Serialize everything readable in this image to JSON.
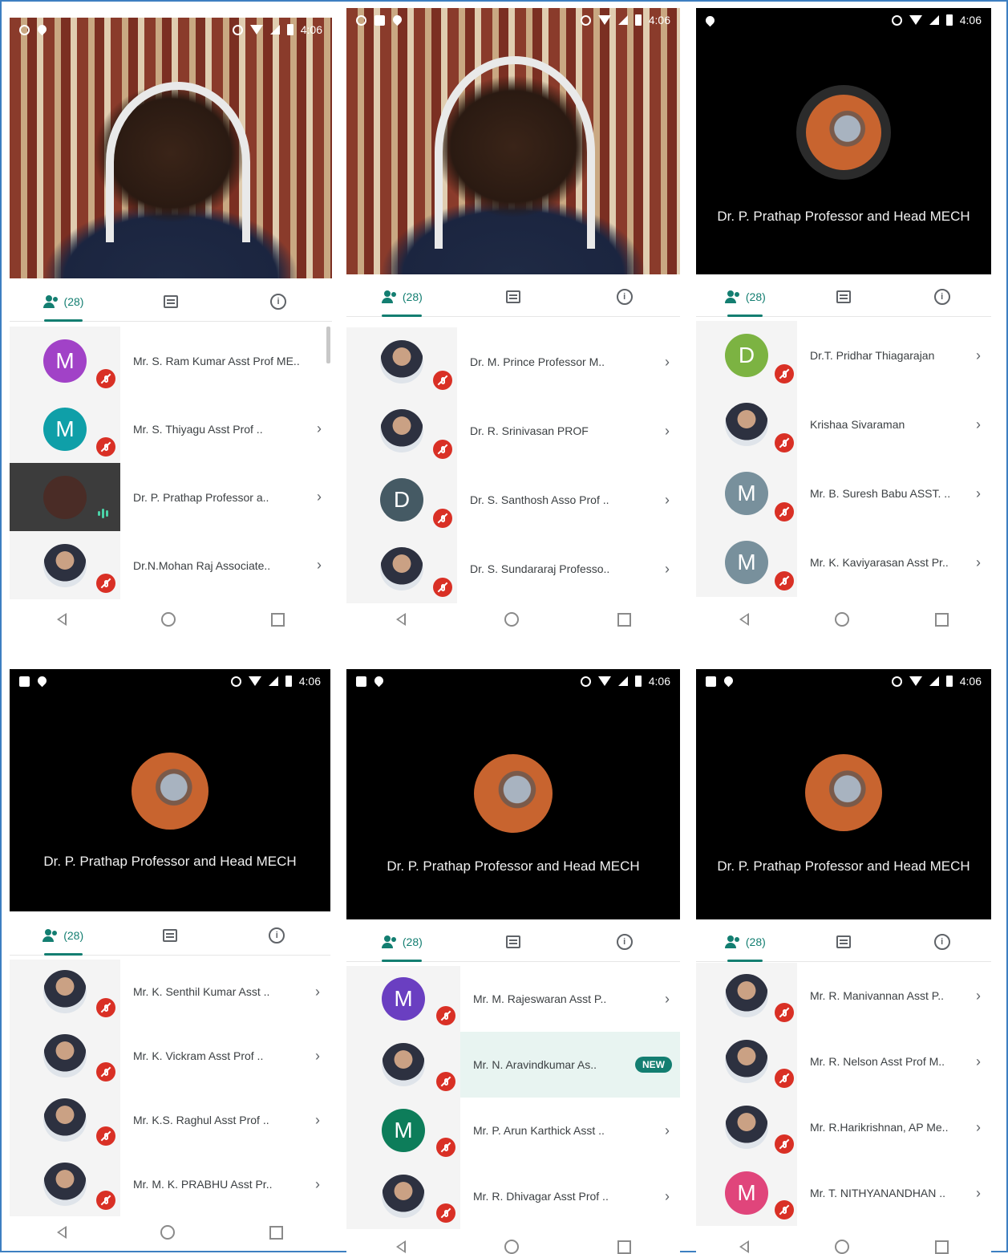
{
  "status_time": "4:06",
  "participants_count": "(28)",
  "presenter_name": "Dr. P. Prathap Professor and Head MECH",
  "panels": [
    {
      "rows": [
        {
          "name": "Mr. S. Ram Kumar Asst Prof ME..",
          "initial": "M",
          "color": "#a142c7"
        },
        {
          "name": "Mr. S. Thiyagu Asst Prof ..",
          "initial": "M",
          "color": "#0f9fa8"
        },
        {
          "name": "Dr. P. Prathap Professor a..",
          "initial": "",
          "color": "#4a2c26"
        },
        {
          "name": "Dr.N.Mohan Raj Associate..",
          "initial": "",
          "color": ""
        }
      ]
    },
    {
      "rows": [
        {
          "name": "Dr. M. Prince Professor M..",
          "initial": "",
          "color": ""
        },
        {
          "name": "Dr. R. Srinivasan PROF",
          "initial": "",
          "color": ""
        },
        {
          "name": "Dr. S. Santhosh Asso Prof ..",
          "initial": "D",
          "color": "#455a64"
        },
        {
          "name": "Dr. S. Sundararaj Professo..",
          "initial": "",
          "color": ""
        }
      ]
    },
    {
      "rows": [
        {
          "name": "Dr.T. Pridhar Thiagarajan",
          "initial": "D",
          "color": "#7cb342"
        },
        {
          "name": "Krishaa Sivaraman",
          "initial": "",
          "color": ""
        },
        {
          "name": "Mr. B. Suresh Babu ASST. ..",
          "initial": "M",
          "color": "#78909c"
        },
        {
          "name": "Mr. K. Kaviyarasan Asst Pr..",
          "initial": "M",
          "color": "#78909c"
        }
      ]
    },
    {
      "rows": [
        {
          "name": "Mr. K. Senthil Kumar Asst ..",
          "initial": "",
          "color": ""
        },
        {
          "name": "Mr. K. Vickram Asst Prof ..",
          "initial": "",
          "color": ""
        },
        {
          "name": "Mr. K.S. Raghul Asst Prof ..",
          "initial": "",
          "color": ""
        },
        {
          "name": "Mr. M. K. PRABHU Asst Pr..",
          "initial": "",
          "color": ""
        }
      ]
    },
    {
      "rows": [
        {
          "name": "Mr. M. Rajeswaran Asst P..",
          "initial": "M",
          "color": "#6a3fc1"
        },
        {
          "name": "Mr. N. Aravindkumar As..",
          "initial": "",
          "color": ""
        },
        {
          "name": "Mr. P. Arun Karthick Asst ..",
          "initial": "M",
          "color": "#0d7d5a"
        },
        {
          "name": "Mr. R. Dhivagar Asst Prof ..",
          "initial": "",
          "color": ""
        }
      ]
    },
    {
      "rows": [
        {
          "name": "Mr. R. Manivannan Asst P..",
          "initial": "",
          "color": ""
        },
        {
          "name": "Mr. R. Nelson Asst Prof M..",
          "initial": "",
          "color": ""
        },
        {
          "name": "Mr. R.Harikrishnan, AP Me..",
          "initial": "",
          "color": ""
        },
        {
          "name": "Mr. T. NITHYANANDHAN ..",
          "initial": "M",
          "color": "#e0457b"
        }
      ]
    }
  ],
  "new_badge": "NEW"
}
